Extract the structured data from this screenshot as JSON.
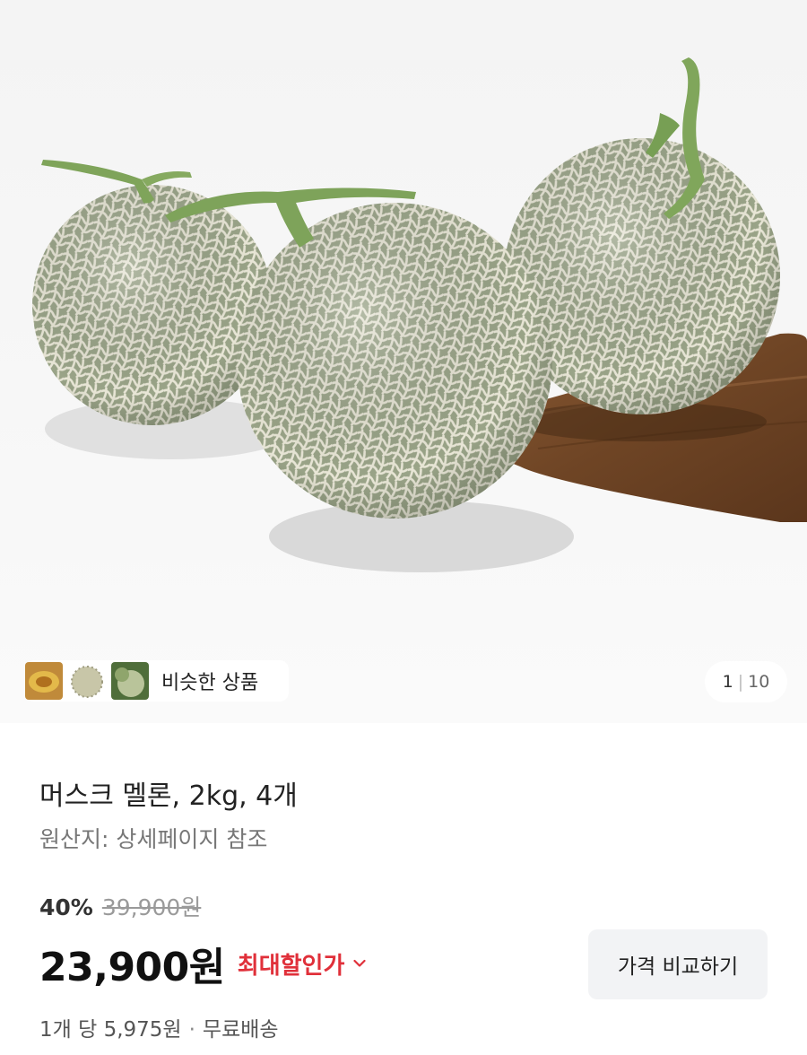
{
  "gallery": {
    "similar_products_label": "비슷한 상품",
    "page_current": "1",
    "page_separator": "|",
    "page_total": "10"
  },
  "product": {
    "title": "머스크 멜론, 2kg, 4개",
    "origin": "원산지: 상세페이지 참조",
    "discount_rate": "40%",
    "original_price": "39,900원",
    "sale_price": "23,900원",
    "max_discount_label": "최대할인가",
    "compare_button_label": "가격 비교하기",
    "unit_price": "1개 당 5,975원",
    "unit_separator": "·",
    "shipping": "무료배송"
  },
  "colors": {
    "discount_red": "#e0303a",
    "button_bg": "#f2f3f5",
    "muted_text": "#777777"
  },
  "icons": [
    "chevron-down-icon"
  ]
}
